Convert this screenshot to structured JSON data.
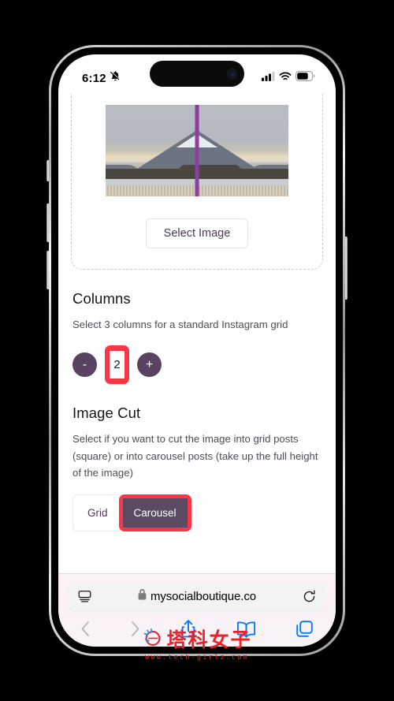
{
  "status_bar": {
    "time": "6:12",
    "mute_icon": "bell-slash-icon",
    "signal_icon": "cellular-signal-icon",
    "wifi_icon": "wifi-icon",
    "battery_icon": "battery-icon"
  },
  "dropzone": {
    "image_alt": "mount-fuji-preview",
    "select_image_label": "Select Image",
    "column_divider_color": "#8c3f9e"
  },
  "columns_section": {
    "title": "Columns",
    "description": "Select 3 columns for a standard Instagram grid",
    "decrement_label": "-",
    "increment_label": "+",
    "value": "2",
    "annotation_color": "#fc3545"
  },
  "image_cut_section": {
    "title": "Image Cut",
    "description": "Select if you want to cut the image into grid posts (square) or into carousel posts (take up the full height of the image)",
    "options": [
      {
        "label": "Grid",
        "selected": false
      },
      {
        "label": "Carousel",
        "selected": true
      }
    ],
    "grid_label": "Grid",
    "carousel_label": "Carousel",
    "selected_color": "#5c4a64",
    "annotation_color": "#fc3545"
  },
  "browser": {
    "reader_icon": "reader-view-icon",
    "lock_icon": "lock-icon",
    "url": "mysocialboutique.co",
    "reload_icon": "reload-icon",
    "back_icon": "back-chevron-icon",
    "forward_icon": "forward-chevron-icon",
    "share_icon": "share-icon",
    "bookmarks_icon": "bookmarks-book-icon",
    "tabs_icon": "tabs-icon",
    "accent_color": "#007aff"
  },
  "watermark": {
    "logo_icon": "tech-girlz-logo-icon",
    "brand": "塔科女子",
    "url": "www.tech-girlz.com",
    "color": "#ef2027"
  }
}
